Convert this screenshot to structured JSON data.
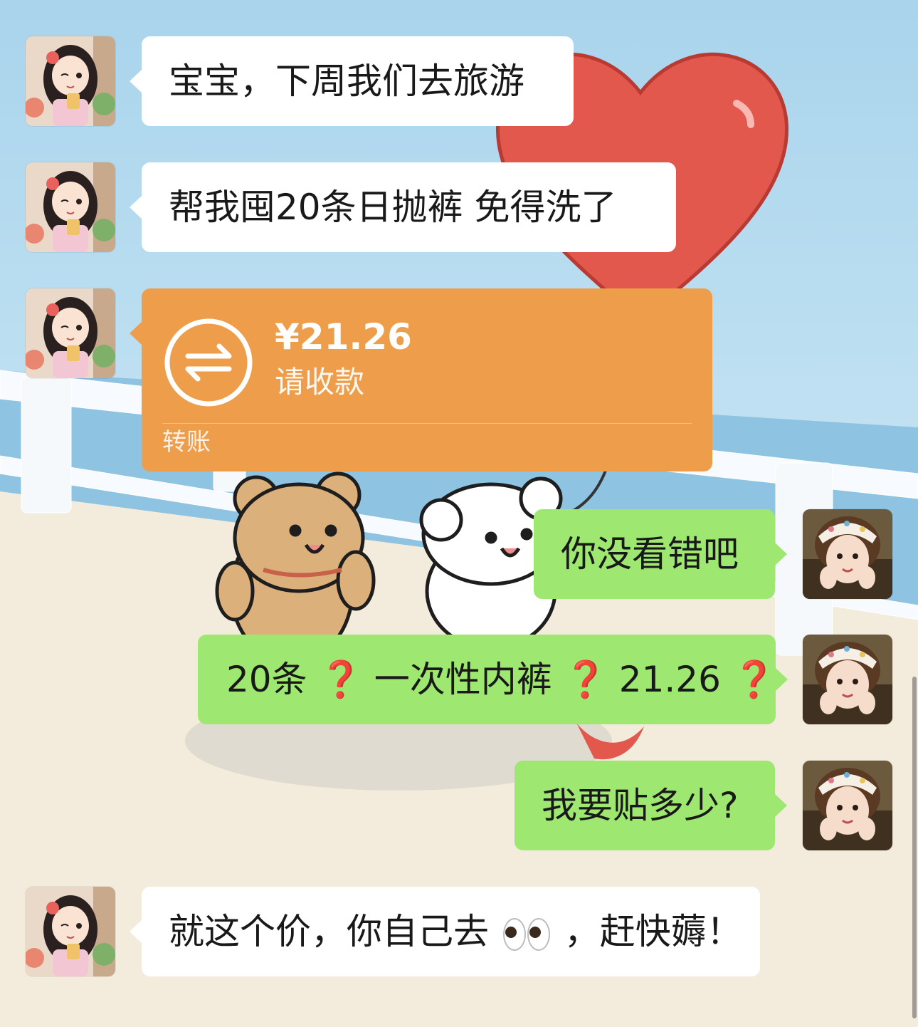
{
  "chat": {
    "messages": [
      {
        "sender": "other",
        "type": "text",
        "text": "宝宝，下周我们去旅游",
        "avatar": "cartoon-girl-avatar"
      },
      {
        "sender": "other",
        "type": "text",
        "text": "帮我囤20条日抛裤 免得洗了",
        "avatar": "cartoon-girl-avatar"
      },
      {
        "sender": "other",
        "type": "transfer",
        "amount": "¥21.26",
        "status": "请收款",
        "label": "转账",
        "icon": "transfer-arrows-icon",
        "avatar": "cartoon-girl-avatar"
      },
      {
        "sender": "self",
        "type": "text",
        "text": "你没看错吧",
        "avatar": "photo-girl-avatar"
      },
      {
        "sender": "self",
        "type": "text",
        "parts": [
          "20条",
          "❓",
          "一次性内裤",
          "❓",
          "21.26",
          "❓"
        ],
        "avatar": "photo-girl-avatar"
      },
      {
        "sender": "self",
        "type": "text",
        "text": "我要贴多少?",
        "avatar": "photo-girl-avatar"
      },
      {
        "sender": "other",
        "type": "text",
        "parts": [
          "就这个价，你自己去",
          "👀",
          "，赶快薅！"
        ],
        "avatar": "cartoon-girl-avatar"
      }
    ]
  },
  "colors": {
    "self_bubble": "#9ee872",
    "other_bubble": "#ffffff",
    "transfer_card": "#ee9e4a",
    "question_mark": "#d8231f"
  },
  "background": {
    "description_icons": [
      "heart-balloon",
      "teddy-bear",
      "white-puppy",
      "railing"
    ]
  }
}
